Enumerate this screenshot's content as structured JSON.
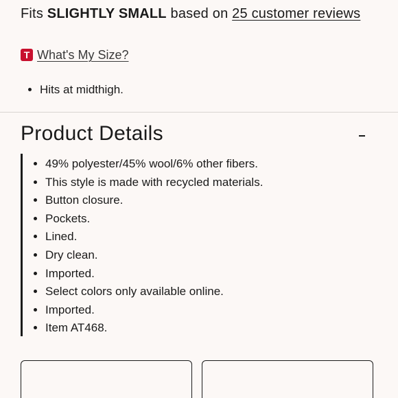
{
  "fit": {
    "prefix": "Fits",
    "rating": "SLIGHTLY SMALL",
    "middle": "based on",
    "reviews_link": "25 customer reviews"
  },
  "size_help": {
    "badge": "T",
    "link": "What's My Size?"
  },
  "fit_notes": [
    "Hits at midthigh."
  ],
  "product_details": {
    "title": "Product Details",
    "toggle_icon": "collapse-minus-icon",
    "items": [
      "49% polyester/45% wool/6% other fibers.",
      "This style is made with recycled materials.",
      "Button closure.",
      "Pockets.",
      "Lined.",
      "Dry clean.",
      "Imported.",
      "Select colors only available online.",
      "Imported.",
      "Item AT468."
    ]
  },
  "colors": {
    "background": "#fcf8f6",
    "text": "#1a1a1a",
    "badge": "#c8102e",
    "divider": "#d9d4d1"
  }
}
